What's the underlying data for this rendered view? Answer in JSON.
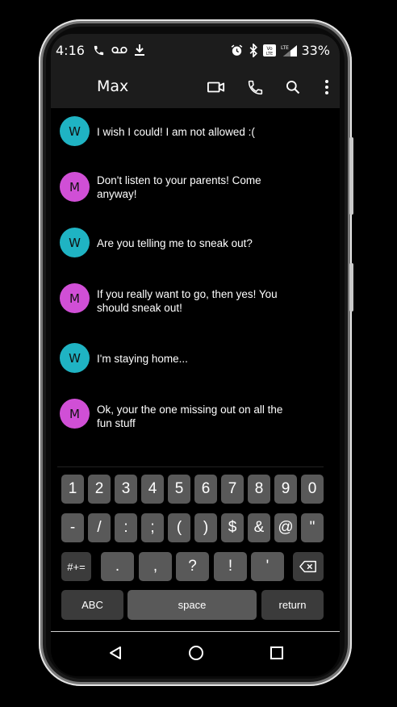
{
  "status_bar": {
    "time": "4:16",
    "battery": "33%",
    "left_icons": [
      "phone-call-icon",
      "voicemail-icon",
      "download-icon"
    ],
    "right_icons": [
      "alarm-icon",
      "bluetooth-icon",
      "volte-icon",
      "lte-signal-icon"
    ]
  },
  "app_bar": {
    "contact_name": "Max",
    "actions": [
      "video-call-icon",
      "phone-icon",
      "search-icon",
      "more-vert-icon"
    ]
  },
  "messages": [
    {
      "sender_initial": "W",
      "avatar_color": "#1fb3c3",
      "text": "I wish I could! I am not allowed :("
    },
    {
      "sender_initial": "M",
      "avatar_color": "#d04fd6",
      "text": "Don't listen to your parents! Come anyway!"
    },
    {
      "sender_initial": "W",
      "avatar_color": "#1fb3c3",
      "text": "Are you telling me to sneak out?"
    },
    {
      "sender_initial": "M",
      "avatar_color": "#d04fd6",
      "text": "If you really want to go, then yes! You should sneak out!"
    },
    {
      "sender_initial": "W",
      "avatar_color": "#1fb3c3",
      "text": "I'm staying home..."
    },
    {
      "sender_initial": "M",
      "avatar_color": "#d04fd6",
      "text": "Ok, your the one missing out on all the fun stuff"
    }
  ],
  "keyboard": {
    "row1": [
      "1",
      "2",
      "3",
      "4",
      "5",
      "6",
      "7",
      "8",
      "9",
      "0"
    ],
    "row2": [
      "-",
      "/",
      ":",
      ";",
      "(",
      ")",
      "$",
      "&",
      "@",
      "\""
    ],
    "row3_toggle": "#+=",
    "row3": [
      ".",
      ",",
      "?",
      "!",
      "'"
    ],
    "row4_left": "ABC",
    "space": "space",
    "return": "return"
  },
  "nav_bar": [
    "back-icon",
    "home-icon",
    "recents-icon"
  ]
}
